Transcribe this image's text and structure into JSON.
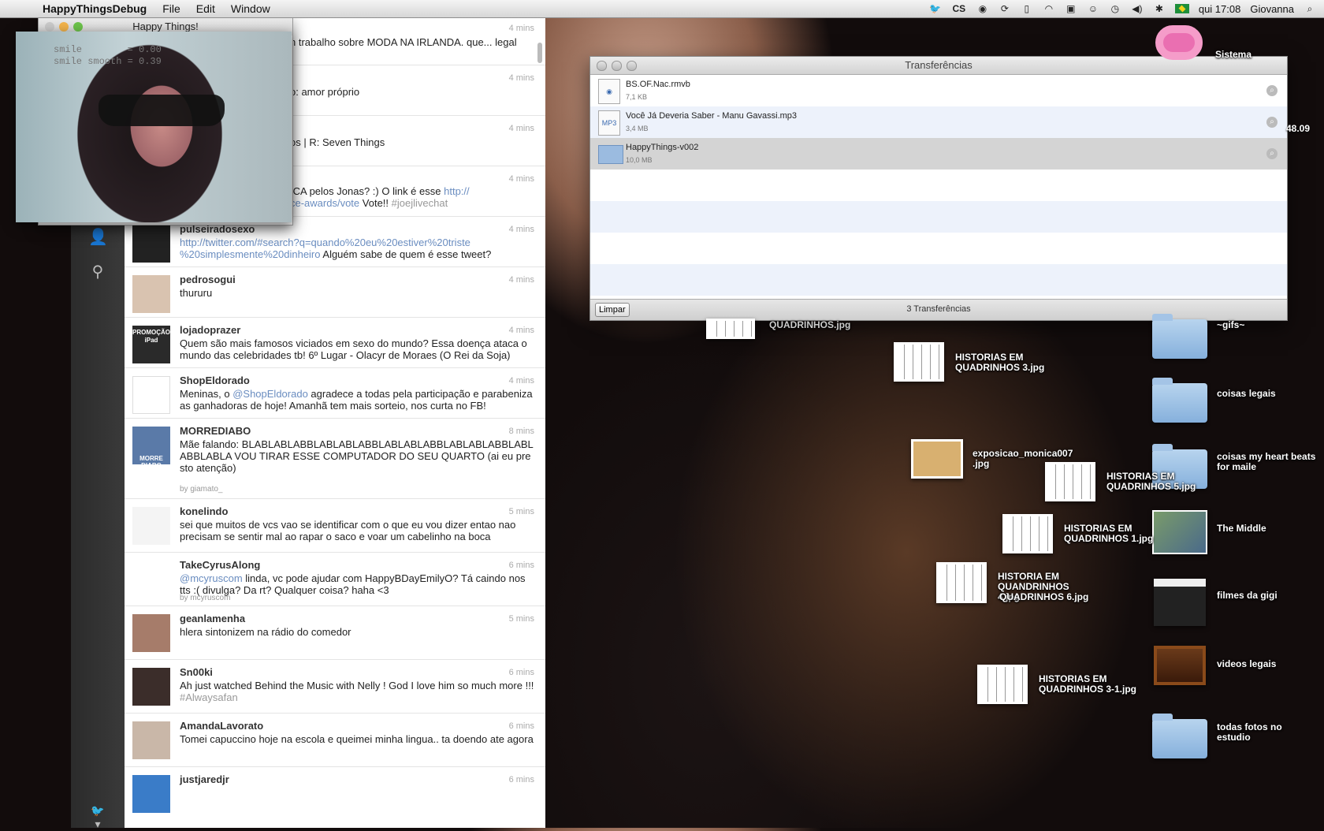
{
  "menubar": {
    "app_name": "HappyThingsDebug",
    "menus": [
      "File",
      "Edit",
      "Window"
    ],
    "clock": "qui 17:08",
    "user": "Giovanna",
    "cs_label": "CS"
  },
  "happy_window": {
    "title": "Happy Things!",
    "readout": "smile        = 0.00\nsmile smooth = 0.39"
  },
  "tweets": [
    {
      "user": "",
      "time": "4 mins",
      "text": "n trabalho sobre MODA NA IRLANDA. que... legal",
      "via": ""
    },
    {
      "user": "",
      "time": "4 mins",
      "text": "o: amor próprio",
      "via": ""
    },
    {
      "user": "",
      "time": "4 mins",
      "text": "os | R: Seven Things",
      "via": ""
    },
    {
      "user": "",
      "time": "4 mins",
      "text_pre": "ICA pelos Jonas? :) O link é esse ",
      "link": "http://",
      "text_line2": "ce-awards/vote",
      "text_post": " Vote!! ",
      "tag": "#joejlivechat",
      "via": ""
    },
    {
      "user": "pulseiradosexo",
      "time": "4 mins",
      "link": "http://twitter.com/#search?q=quando%20eu%20estiver%20triste %20simplesmente%20dinheiro",
      "text_post": " Alguém sabe de quem é esse tweet?",
      "via": ""
    },
    {
      "user": "pedrosogui",
      "time": "4 mins",
      "text": "thururu",
      "via": ""
    },
    {
      "user": "lojadoprazer",
      "time": "4 mins",
      "text": "Quem são mais famosos viciados em sexo do mundo?  Essa doença ataca o mundo das celebridades tb! 6º Lugar - Olacyr de Moraes (O Rei da Soja)",
      "via": "",
      "avatar_text": "PROMOÇÃO iPad"
    },
    {
      "user": "ShopEldorado",
      "time": "4 mins",
      "text_pre": "Meninas, o ",
      "link": "@ShopEldorado",
      "text_post": " agradece a todas pela participação e parabeniza as ganhadoras de hoje! Amanhã tem mais sorteio, nos curta no FB!",
      "via": ""
    },
    {
      "user": "MORREDIABO",
      "time": "8 mins",
      "text": "Mãe falando: BLABLABLABBLABLABLABBLABLABLABBLABLABLABBLABLABBLABLA VOU TIRAR ESSE COMPUTADOR DO SEU QUARTO (ai eu presto atenção)",
      "via": "by giamato_",
      "avatar_text": "MORRE DIABO"
    },
    {
      "user": "konelindo",
      "time": "5 mins",
      "text": "sei que muitos de vcs vao se identificar com o que eu vou dizer entao nao precisam se sentir mal ao rapar o saco e voar um cabelinho na boca",
      "via": ""
    },
    {
      "user": "TakeCyrusAlong",
      "time": "6 mins",
      "link": "@mcyruscom",
      "text_post": " linda, vc pode ajudar com HappyBDayEmilyO? Tá caindo nos tts :( divulga? Da rt? Qualquer coisa? haha <3",
      "via": "by mcyruscom"
    },
    {
      "user": "geanlamenha",
      "time": "5 mins",
      "text": "hlera sintonizem na rádio do comedor",
      "via": ""
    },
    {
      "user": "Sn00ki",
      "time": "6 mins",
      "text_pre": "Ah just watched Behind the Music with Nelly ! God I love him so much more !!! ",
      "tag": "#Alwaysafan",
      "via": ""
    },
    {
      "user": "AmandaLavorato",
      "time": "6 mins",
      "text": "Tomei capuccino hoje na escola e queimei minha lingua.. ta doendo ate agora",
      "via": ""
    },
    {
      "user": "justjaredjr",
      "time": "6 mins",
      "text": "",
      "via": ""
    }
  ],
  "transfers": {
    "title": "Transferências",
    "items": [
      {
        "name": "BS.OF.Nac.rmvb",
        "size": "7,1 KB",
        "type": "file"
      },
      {
        "name": "Você Já Deveria Saber - Manu Gavassi.mp3",
        "size": "3,4 MB",
        "type": "mp3"
      },
      {
        "name": "HappyThings-v002",
        "size": "10,0 MB",
        "type": "folder"
      }
    ],
    "clear_button": "Limpar",
    "count_label": "3 Transferências",
    "mp3_tag": "MP3"
  },
  "desktop": {
    "icons": [
      {
        "label": "Sistema"
      },
      {
        "label": "48.09"
      },
      {
        "label": "~gifs~"
      },
      {
        "label": "coisas legais"
      },
      {
        "label": "coisas my heart beats for maile"
      },
      {
        "label": "The Middle"
      },
      {
        "label": "filmes da gigi"
      },
      {
        "label": "videos legais"
      },
      {
        "label": "todas fotos no estudio"
      },
      {
        "label": "HISTORIAS EM QUADRINHOS 3.jpg"
      },
      {
        "label": "exposicao_monica007 .jpg"
      },
      {
        "label": "HISTORIAS EM QUADRINHOS 5.jpg"
      },
      {
        "label": "HISTORIAS EM QUADRINHOS 1.jpg"
      },
      {
        "label": "HISTORIA EM QUANDRINHOS 4.jpg"
      },
      {
        "label": "QUADRINHOS 6.jpg"
      },
      {
        "label": "HISTORIAS EM QUADRINHOS 3-1.jpg"
      },
      {
        "label": "QUADRINHOS.jpg"
      }
    ]
  }
}
